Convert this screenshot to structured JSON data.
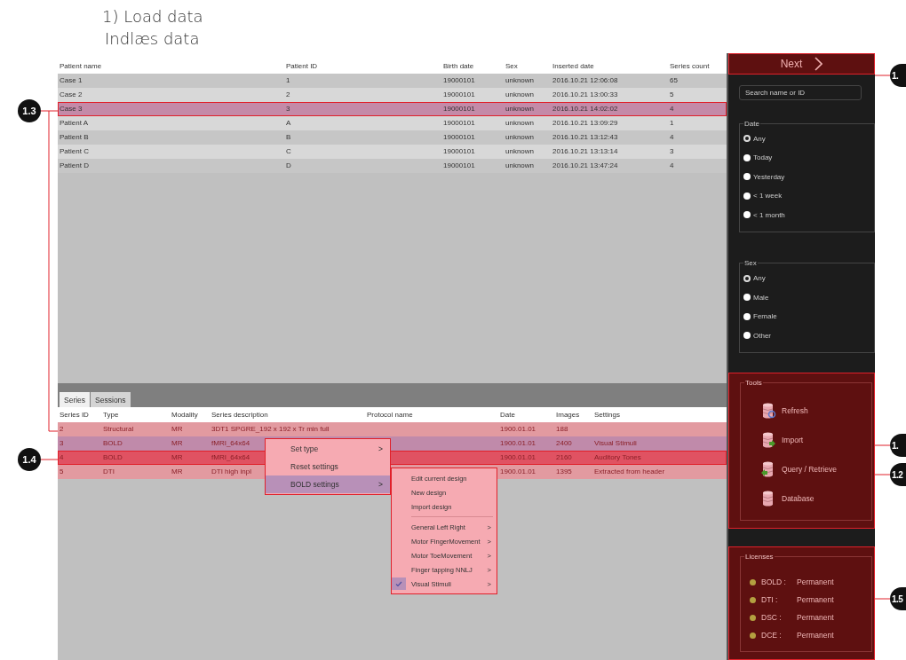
{
  "heading": {
    "title": "1) Load data",
    "subtitle": "Indlæs data"
  },
  "patients": {
    "columns": [
      "Patient name",
      "Patient ID",
      "Birth date",
      "Sex",
      "Inserted date",
      "Series count"
    ],
    "rows": [
      {
        "cells": [
          "Case 1",
          "1",
          "19000101",
          "unknown",
          "2016.10.21 12:06:08",
          "65"
        ],
        "selected": false,
        "outlined": false
      },
      {
        "cells": [
          "Case 2",
          "2",
          "19000101",
          "unknown",
          "2016.10.21 13:00:33",
          "5"
        ],
        "selected": false,
        "outlined": false
      },
      {
        "cells": [
          "Case 3",
          "3",
          "19000101",
          "unknown",
          "2016.10.21 14:02:02",
          "4"
        ],
        "selected": true,
        "outlined": true
      },
      {
        "cells": [
          "Patient A",
          "A",
          "19000101",
          "unknown",
          "2016.10.21 13:09:29",
          "1"
        ],
        "selected": false,
        "outlined": false
      },
      {
        "cells": [
          "Patient B",
          "B",
          "19000101",
          "unknown",
          "2016.10.21 13:12:43",
          "4"
        ],
        "selected": false,
        "outlined": false
      },
      {
        "cells": [
          "Patient C",
          "C",
          "19000101",
          "unknown",
          "2016.10.21 13:13:14",
          "3"
        ],
        "selected": false,
        "outlined": false
      },
      {
        "cells": [
          "Patient D",
          "D",
          "19000101",
          "unknown",
          "2016.10.21 13:47:24",
          "4"
        ],
        "selected": false,
        "outlined": false
      }
    ]
  },
  "tabs": [
    {
      "label": "Series",
      "selected": true
    },
    {
      "label": "Sessions",
      "selected": false
    }
  ],
  "series": {
    "columns": [
      "Series ID",
      "Type",
      "Modality",
      "Series description",
      "Protocol name",
      "Date",
      "Images",
      "Settings"
    ],
    "rows": [
      {
        "cells": [
          "2",
          "Structural",
          "MR",
          "3DT1 SPGRE_192 x 192 x Tr min full",
          "",
          "1900.01.01",
          "188",
          ""
        ],
        "selected": false,
        "hovered": false,
        "outlined": false
      },
      {
        "cells": [
          "3",
          "BOLD",
          "MR",
          "fMRI_64x64",
          "",
          "1900.01.01",
          "2400",
          "Visual Stimuli"
        ],
        "selected": true,
        "hovered": false,
        "outlined": false
      },
      {
        "cells": [
          "4",
          "BOLD",
          "MR",
          "fMRI_64x64",
          "",
          "1900.01.01",
          "2160",
          "Auditory Tones"
        ],
        "selected": false,
        "hovered": true,
        "outlined": true
      },
      {
        "cells": [
          "5",
          "DTI",
          "MR",
          "DTI high inpl",
          "",
          "1900.01.01",
          "1395",
          "Extracted from header"
        ],
        "selected": false,
        "hovered": false,
        "outlined": false
      }
    ]
  },
  "context_menu": {
    "items": [
      {
        "label": "Set type",
        "arrow": ">",
        "selected": false
      },
      {
        "label": "Reset settings",
        "selected": false
      },
      {
        "label": "BOLD settings",
        "arrow": ">",
        "selected": true
      }
    ]
  },
  "submenu": {
    "items": [
      {
        "kind": "item",
        "label": "Edit current design",
        "checked": false
      },
      {
        "kind": "item",
        "label": "New design",
        "checked": false
      },
      {
        "kind": "item",
        "label": "Import design",
        "checked": false
      },
      {
        "kind": "separator"
      },
      {
        "kind": "item",
        "label": "General Left Right",
        "arrow": ">",
        "checked": false
      },
      {
        "kind": "item",
        "label": "Motor FingerMovement",
        "arrow": ">",
        "checked": false
      },
      {
        "kind": "item",
        "label": "Motor ToeMovement",
        "arrow": ">",
        "checked": false
      },
      {
        "kind": "item",
        "label": "Finger tapping NNLJ",
        "arrow": ">",
        "checked": false
      },
      {
        "kind": "item",
        "label": "Visual Stimuli",
        "arrow": ">",
        "checked": true
      }
    ]
  },
  "sidebar": {
    "next_button": "Next",
    "search": {
      "placeholder": "Search name or ID"
    },
    "filters": [
      {
        "legend": "Date",
        "options": [
          {
            "label": "Any",
            "selected": true
          },
          {
            "label": "Today",
            "selected": false
          },
          {
            "label": "Yesterday",
            "selected": false
          },
          {
            "label": "< 1 week",
            "selected": false
          },
          {
            "label": "< 1 month",
            "selected": false
          }
        ]
      },
      {
        "legend": "Sex",
        "options": [
          {
            "label": "Any",
            "selected": true
          },
          {
            "label": "Male",
            "selected": false
          },
          {
            "label": "Female",
            "selected": false
          },
          {
            "label": "Other",
            "selected": false
          }
        ]
      }
    ],
    "tools": {
      "legend": "Tools",
      "items": [
        {
          "kind": "refresh",
          "label": "Refresh"
        },
        {
          "kind": "import",
          "label": "Import"
        },
        {
          "kind": "query",
          "label": "Query / Retrieve"
        },
        {
          "kind": "database",
          "label": "Database"
        }
      ]
    },
    "licenses": {
      "legend": "Licenses",
      "items": [
        {
          "name": "BOLD :",
          "status": "Permanent"
        },
        {
          "name": "DTI :",
          "status": "Permanent"
        },
        {
          "name": "DSC :",
          "status": "Permanent"
        },
        {
          "name": "DCE :",
          "status": "Permanent"
        }
      ]
    }
  },
  "callouts": [
    {
      "label": "1.3"
    },
    {
      "label": "1.4"
    },
    {
      "label": "1."
    },
    {
      "label": "1."
    },
    {
      "label": "1.2"
    },
    {
      "label": "1.5"
    }
  ]
}
